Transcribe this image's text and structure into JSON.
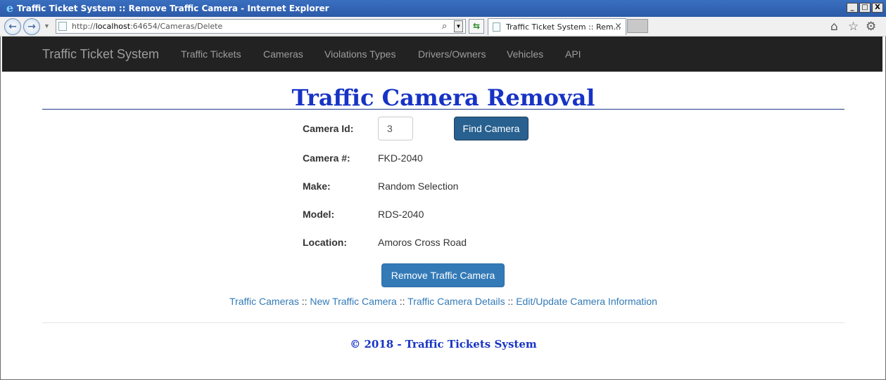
{
  "window": {
    "title": "Traffic Ticket System :: Remove Traffic Camera - Internet Explorer",
    "minimize": "_",
    "maximize": "□",
    "close": "X"
  },
  "browser": {
    "url_prefix": "http://",
    "url_host": "localhost",
    "url_rest": ":64654/Cameras/Delete",
    "tab_title": "Traffic Ticket System :: Rem...",
    "tab_close": "×",
    "icons": {
      "back": "back-arrow-icon",
      "forward": "forward-arrow-icon",
      "search": "search-icon",
      "refresh": "refresh-icon",
      "home": "home-icon",
      "favorites": "star-icon",
      "tools": "gear-icon"
    }
  },
  "navbar": {
    "brand": "Traffic Ticket System",
    "items": [
      "Traffic Tickets",
      "Cameras",
      "Violations Types",
      "Drivers/Owners",
      "Vehicles",
      "API"
    ]
  },
  "page": {
    "title": "Traffic Camera Removal",
    "form": {
      "camera_id_label": "Camera Id:",
      "camera_id_value": "3",
      "find_button": "Find Camera",
      "camera_number_label": "Camera #:",
      "camera_number_value": "FKD-2040",
      "make_label": "Make:",
      "make_value": "Random Selection",
      "model_label": "Model:",
      "model_value": "RDS-2040",
      "location_label": "Location:",
      "location_value": "Amoros Cross Road",
      "remove_button": "Remove Traffic Camera"
    },
    "links": [
      "Traffic Cameras",
      "New Traffic Camera",
      "Traffic Camera Details",
      "Edit/Update Camera Information"
    ],
    "link_separator": " :: ",
    "footer": "© 2018 - Traffic Tickets System"
  },
  "colors": {
    "title_blue": "#1733c5",
    "navbar_bg": "#222222",
    "primary_button": "#337ab7",
    "link": "#337ab7"
  }
}
